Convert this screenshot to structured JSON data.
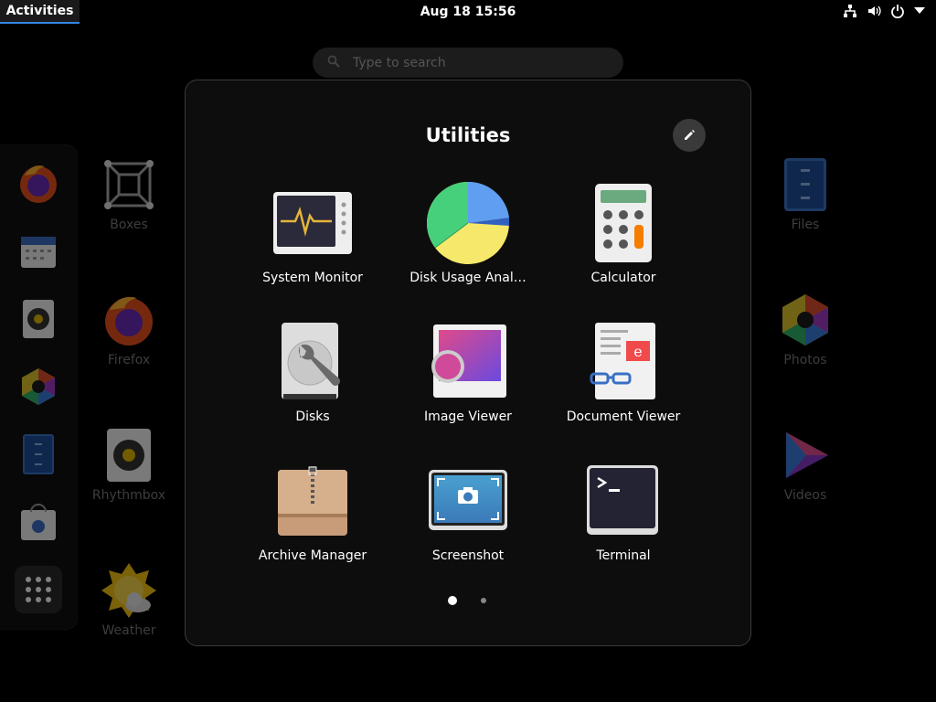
{
  "topbar": {
    "activities": "Activities",
    "clock": "Aug 18  15:56",
    "icons": [
      "network-icon",
      "volume-icon",
      "power-icon",
      "chevron-down-icon"
    ]
  },
  "search": {
    "placeholder": "Type to search"
  },
  "dash": {
    "items": [
      "firefox",
      "calendar",
      "rhythmbox",
      "photos",
      "files",
      "software",
      "show-apps"
    ]
  },
  "background_apps": {
    "left": [
      "Boxes",
      "Firefox",
      "Rhythmbox",
      "Weather"
    ],
    "right": [
      "Files",
      "Photos",
      "Videos"
    ]
  },
  "folder": {
    "title": "Utilities",
    "apps": [
      {
        "label": "System Monitor"
      },
      {
        "label": "Disk Usage Anal…"
      },
      {
        "label": "Calculator"
      },
      {
        "label": "Disks"
      },
      {
        "label": "Image Viewer"
      },
      {
        "label": "Document Viewer"
      },
      {
        "label": "Archive Manager"
      },
      {
        "label": "Screenshot"
      },
      {
        "label": "Terminal"
      }
    ],
    "pages": {
      "count": 2,
      "current": 1
    }
  },
  "colors": {
    "accent": "#3584e4",
    "folder_bg": "#0e0e0e",
    "label_dim": "#7a7a7a"
  }
}
